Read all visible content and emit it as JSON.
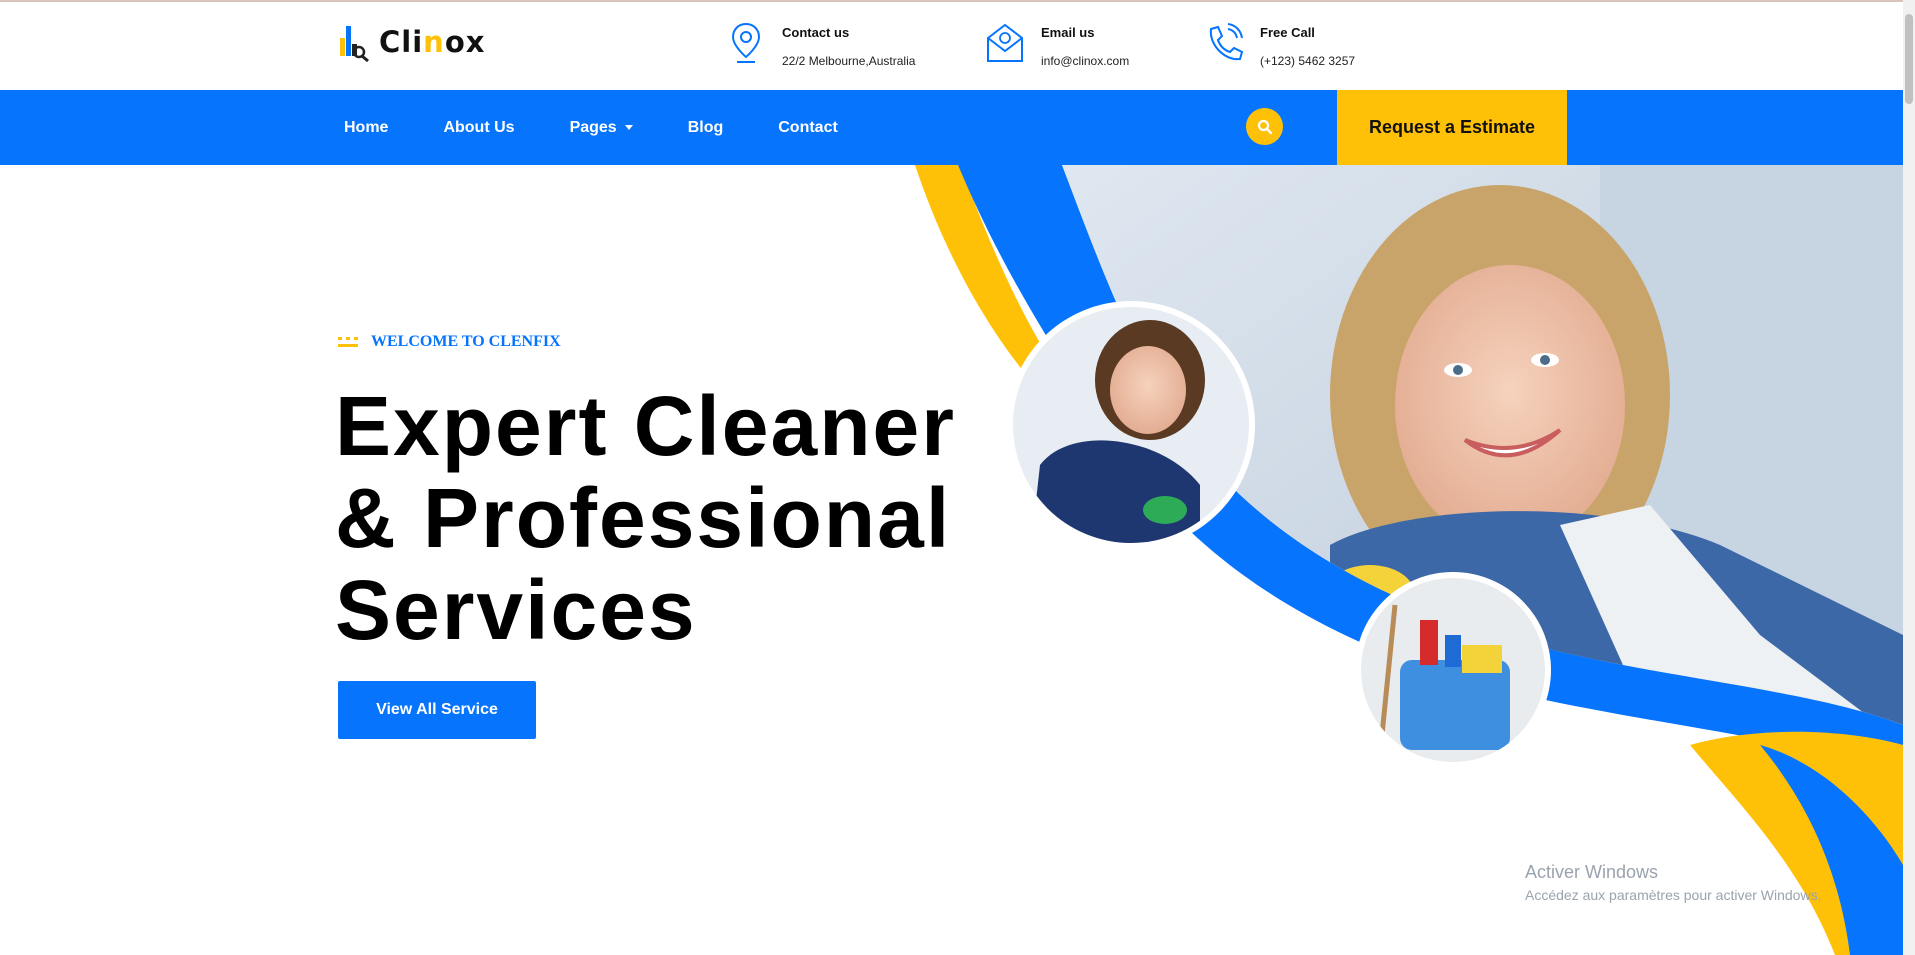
{
  "brand": {
    "name_prefix": "Cli",
    "name_accent": "n",
    "name_suffix": "ox"
  },
  "contacts": [
    {
      "icon": "location-pin-icon",
      "title": "Contact us",
      "value": "22/2 Melbourne,Australia"
    },
    {
      "icon": "email-icon",
      "title": "Email us",
      "value": "info@clinox.com"
    },
    {
      "icon": "phone-icon",
      "title": "Free Call",
      "value": "(+123) 5462 3257"
    }
  ],
  "nav": {
    "items": [
      "Home",
      "About Us",
      "Pages",
      "Blog",
      "Contact"
    ],
    "search_icon": "search-icon",
    "estimate_label": "Request a Estimate"
  },
  "hero": {
    "eyebrow": "WELCOME TO CLENFIX",
    "headline_lines": [
      "Expert Cleaner",
      "& Professional",
      "Services"
    ],
    "cta_label": "View All Service"
  },
  "watermark": {
    "title": "Activer Windows",
    "subtitle": "Accédez aux paramètres pour activer Windows."
  },
  "colors": {
    "primary": "#0674fd",
    "accent": "#ffc107"
  }
}
